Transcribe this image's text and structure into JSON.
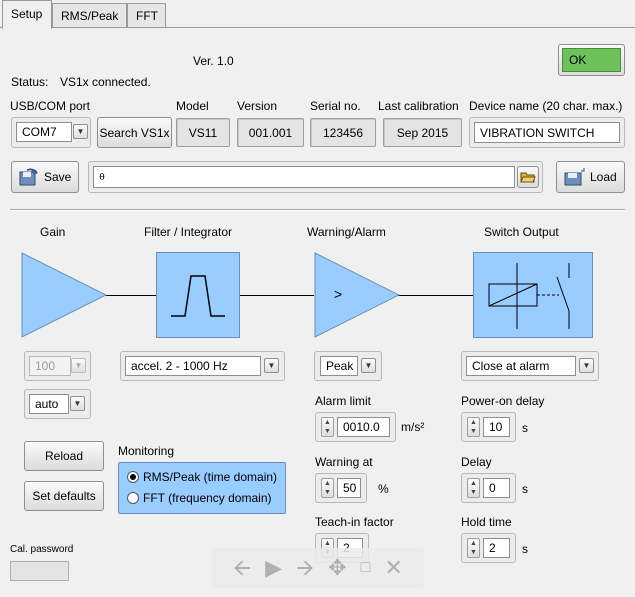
{
  "tabs": [
    {
      "label": "Setup"
    },
    {
      "label": "RMS/Peak"
    },
    {
      "label": "FFT"
    }
  ],
  "header": {
    "version": "Ver. 1.0",
    "status_label": "Status:",
    "status_text": "VS1x connected.",
    "ok_label": "OK",
    "ok_color": "#6ec25a"
  },
  "device": {
    "port_label": "USB/COM port",
    "port_value": "COM7",
    "search_label": "Search VS1x",
    "model_label": "Model",
    "model_value": "VS11",
    "version_label": "Version",
    "version_value": "001.001",
    "serial_label": "Serial no.",
    "serial_value": "123456",
    "calib_label": "Last calibration",
    "calib_value": "Sep  2015",
    "name_label": "Device name (20 char. max.)",
    "name_value": "VIBRATION SWITCH"
  },
  "file": {
    "save_label": "Save",
    "path_value": "",
    "load_label": "Load"
  },
  "chain": {
    "gain_title": "Gain",
    "filter_title": "Filter / Integrator",
    "warning_title": "Warning/Alarm",
    "switch_title": "Switch Output",
    "block_color": "#99ccff"
  },
  "gain": {
    "value": "100",
    "mode": "auto"
  },
  "filter": {
    "value": "accel.  2 - 1000 Hz"
  },
  "warning": {
    "mode": "Peak",
    "alarm_limit_label": "Alarm limit",
    "alarm_limit_value": "0010.0",
    "alarm_unit": "m/s²",
    "warning_at_label": "Warning at",
    "warning_at_value": "50",
    "warning_unit": "%",
    "teach_label": "Teach-in factor",
    "teach_value": "2"
  },
  "switch": {
    "mode": "Close at alarm",
    "power_on_label": "Power-on delay",
    "power_on_value": "10",
    "power_on_unit": "s",
    "delay_label": "Delay",
    "delay_value": "0",
    "delay_unit": "s",
    "hold_label": "Hold time",
    "hold_value": "2",
    "hold_unit": "s"
  },
  "controls": {
    "reload_label": "Reload",
    "defaults_label": "Set defaults",
    "monitoring_label": "Monitoring",
    "radio_rms_label": "RMS/Peak (time domain)",
    "radio_fft_label": "FFT (frequency domain)",
    "cal_password_label": "Cal. password",
    "cal_password_value": ""
  },
  "icons": {
    "dropdown": "chevron-down-icon",
    "spin": "spinner-icon",
    "folder": "folder-open-icon",
    "save": "save-disk-icon",
    "load": "load-disk-icon"
  }
}
